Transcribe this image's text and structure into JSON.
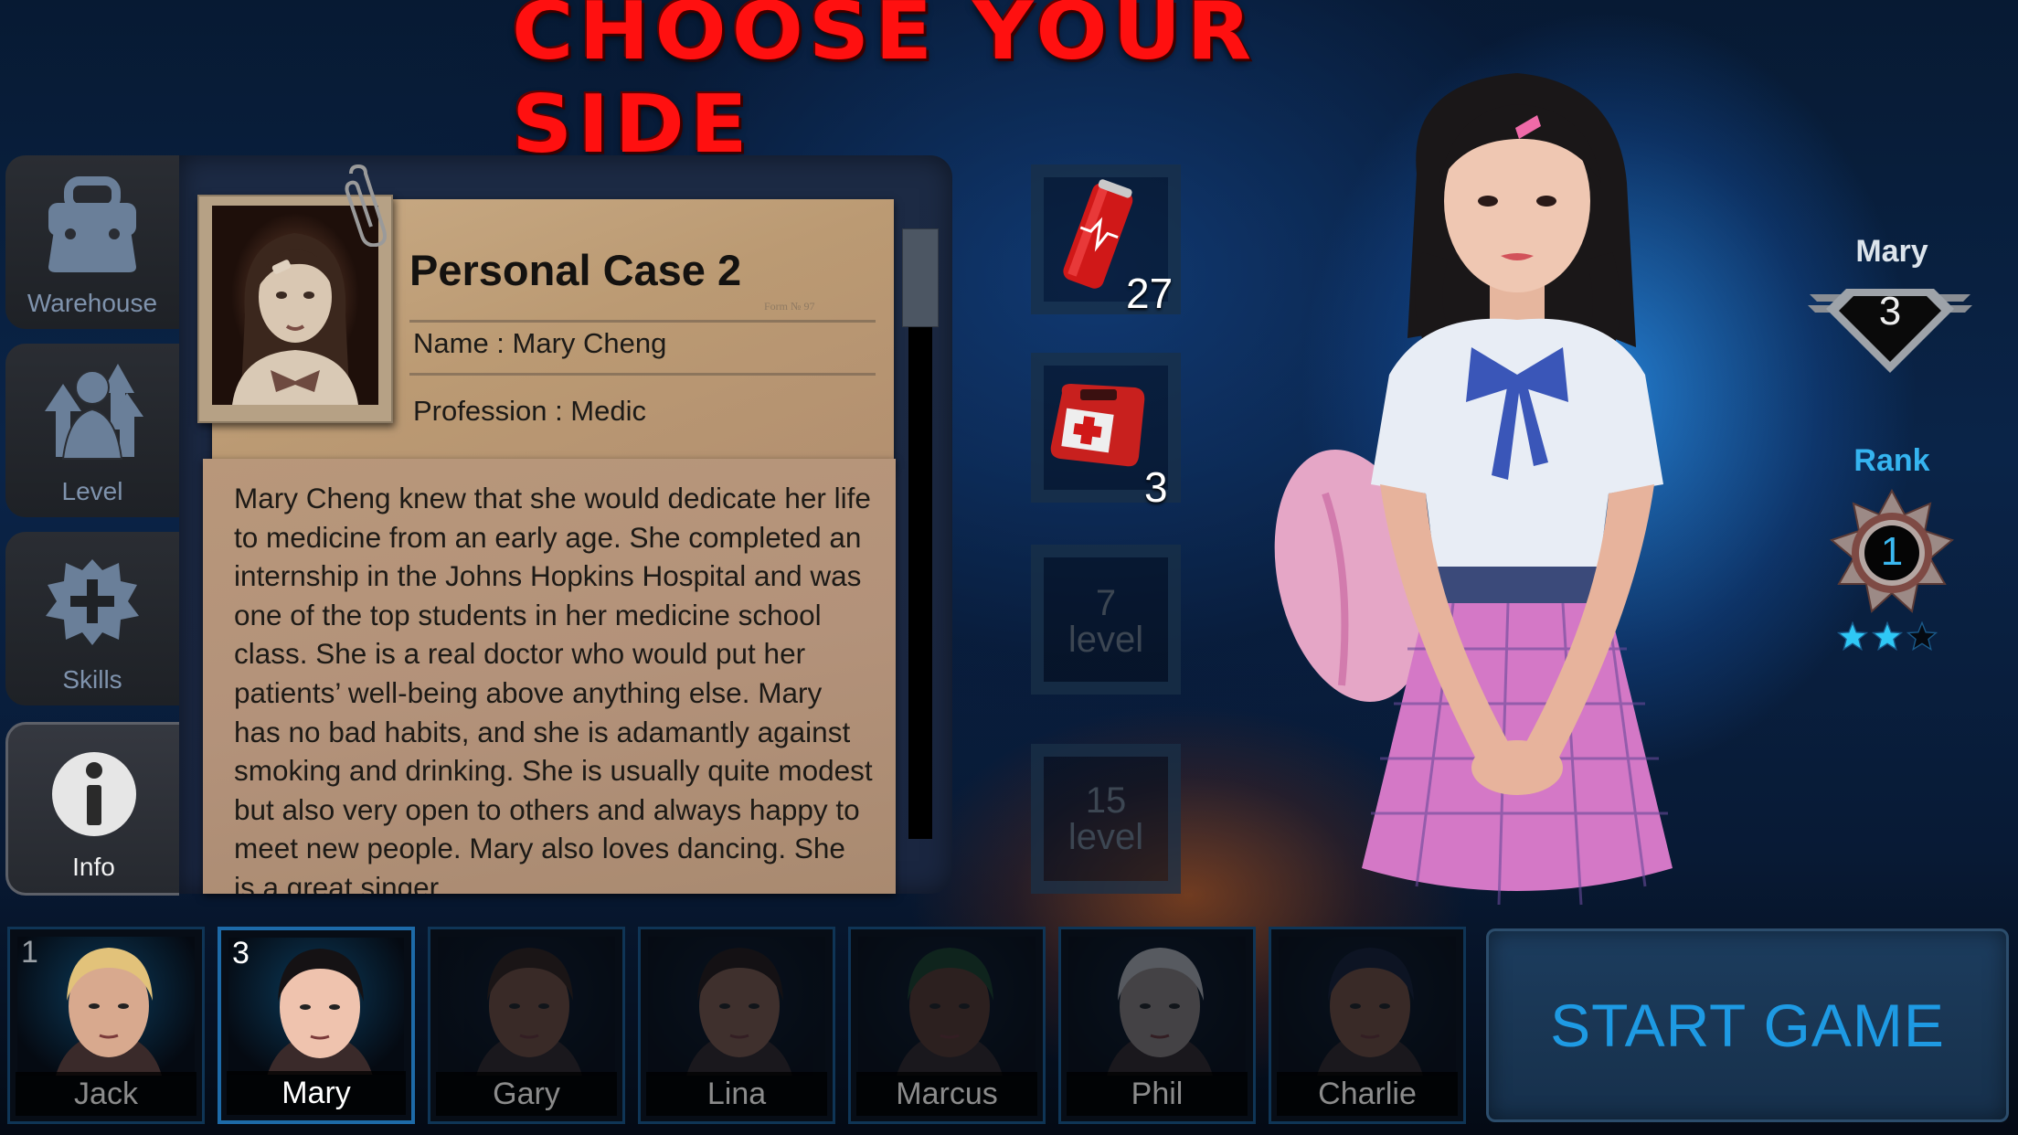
{
  "screen": {
    "title": "CHOOSE YOUR SIDE"
  },
  "sidebar": {
    "items": [
      {
        "label": "Warehouse",
        "icon": "briefcase-icon",
        "active": false
      },
      {
        "label": "Level",
        "icon": "level-up-icon",
        "active": false
      },
      {
        "label": "Skills",
        "icon": "skills-plus-icon",
        "active": false
      },
      {
        "label": "Info",
        "icon": "info-icon",
        "active": true
      }
    ]
  },
  "dossier": {
    "title": "Personal Case 2",
    "form_number": "Form № 97",
    "name_field": "Name : Mary Cheng",
    "profession_field": "Profession : Medic",
    "bio": "Mary Cheng knew that she would dedicate her life to medicine from an early age. She completed an internship in the Johns Hopkins Hospital and was one of the top students in her medicine school class. She is a real doctor who would put her patients’ well-being above anything else. Mary has no bad habits, and she is adamantly against smoking and drinking. She is usually quite modest but also very open to others and always happy to meet new people. Mary also loves dancing. She is a great singer"
  },
  "items": [
    {
      "name": "energy-drink",
      "icon": "soda-can-icon",
      "count": "27"
    },
    {
      "name": "medkit",
      "icon": "first-aid-bag-icon",
      "count": "3"
    },
    {
      "name": "locked-slot-1",
      "unlock_level": "7",
      "unlock_label": "level"
    },
    {
      "name": "locked-slot-2",
      "unlock_level": "15",
      "unlock_label": "level"
    }
  ],
  "character_stats": {
    "name": "Mary",
    "level": "3",
    "rank_label": "Rank",
    "rank": "1",
    "stars_filled": 2,
    "stars_total": 3,
    "star_color": "#2fc8f5"
  },
  "roster": [
    {
      "name": "Jack",
      "level": "1",
      "selected": false,
      "unlocked": true
    },
    {
      "name": "Mary",
      "level": "3",
      "selected": true,
      "unlocked": true
    },
    {
      "name": "Gary",
      "level": "",
      "selected": false,
      "unlocked": false
    },
    {
      "name": "Lina",
      "level": "",
      "selected": false,
      "unlocked": false
    },
    {
      "name": "Marcus",
      "level": "",
      "selected": false,
      "unlocked": false
    },
    {
      "name": "Phil",
      "level": "",
      "selected": false,
      "unlocked": false
    },
    {
      "name": "Charlie",
      "level": "",
      "selected": false,
      "unlocked": false
    }
  ],
  "actions": {
    "start_label": "START GAME"
  },
  "colors": {
    "title_red": "#ff1010",
    "accent_blue": "#1e9ae3",
    "rank_blue": "#35b4f0"
  }
}
